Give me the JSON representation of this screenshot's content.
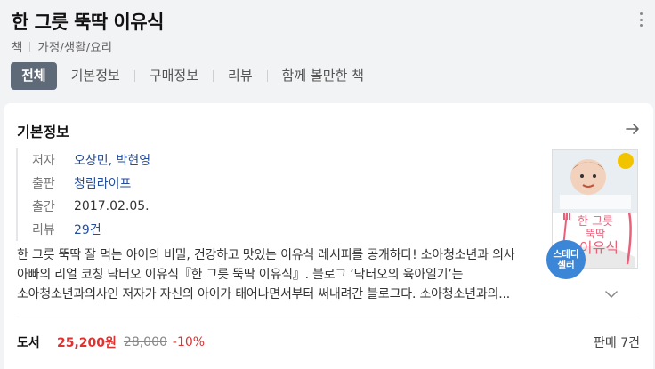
{
  "book": {
    "title": "한 그릇 뚝딱 이유식",
    "category_type": "책",
    "category_path": "가정/생활/요리"
  },
  "tabs": [
    {
      "label": "전체",
      "active": true
    },
    {
      "label": "기본정보",
      "active": false
    },
    {
      "label": "구매정보",
      "active": false
    },
    {
      "label": "리뷰",
      "active": false
    },
    {
      "label": "함께 볼만한 책",
      "active": false
    }
  ],
  "info": {
    "section_title": "기본정보",
    "author_key": "저자",
    "author_value": "오상민, 박현영",
    "publisher_key": "출판",
    "publisher_value": "청림라이프",
    "date_key": "출간",
    "date_value": "2017.02.05.",
    "review_key": "리뷰",
    "review_value": "29건"
  },
  "cover": {
    "title_line1": "한 그릇",
    "title_line2": "뚝딱",
    "title_line3": "이유식"
  },
  "badge": {
    "line1": "스테디",
    "line2": "셀러"
  },
  "description": "한 그릇 뚝딱 잘 먹는 아이의 비밀, 건강하고 맛있는 이유식 레시피를 공개하다! 소아청소년과 의사 아빠의 리얼 코칭 닥터오 이유식『한 그릇 뚝딱 이유식』. 블로그 ‘닥터오의 육아일기’는 소아청소년과의사인 저자가 자신의 아이가 태어나면서부터 써내려간 블로그다. 소아청소년과의...",
  "price": {
    "kind": "도서",
    "current": "25,200원",
    "original": "28,000",
    "discount": "-10%",
    "sellers": "판매 7건"
  },
  "colors": {
    "accent_red": "#e0322f",
    "link_blue": "#254d9b",
    "tab_active_bg": "#5f6a78",
    "badge_blue": "#3b86d6"
  }
}
